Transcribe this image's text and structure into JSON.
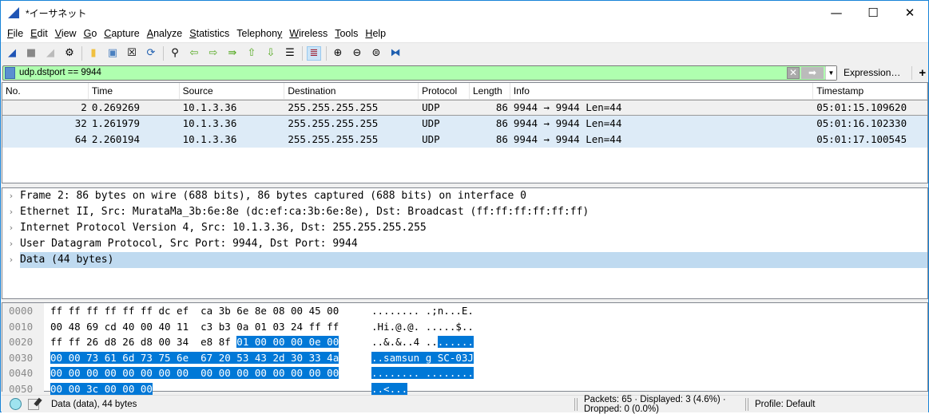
{
  "window": {
    "title": "*イーサネット",
    "controls": {
      "minimize": "—",
      "maximize": "☐",
      "close": "✕"
    }
  },
  "menu": [
    {
      "label": "File",
      "key": "F",
      "rest": "ile"
    },
    {
      "label": "Edit",
      "key": "E",
      "rest": "dit"
    },
    {
      "label": "View",
      "key": "V",
      "rest": "iew"
    },
    {
      "label": "Go",
      "key": "G",
      "rest": "o"
    },
    {
      "label": "Capture",
      "key": "C",
      "rest": "apture"
    },
    {
      "label": "Analyze",
      "key": "A",
      "rest": "nalyze"
    },
    {
      "label": "Statistics",
      "key": "S",
      "rest": "tatistics"
    },
    {
      "label": "Telephony",
      "key": "Telephon",
      "rest": "y"
    },
    {
      "label": "Wireless",
      "key": "W",
      "rest": "ireless"
    },
    {
      "label": "Tools",
      "key": "T",
      "rest": "ools"
    },
    {
      "label": "Help",
      "key": "H",
      "rest": "elp"
    }
  ],
  "toolbar": [
    "start-capture",
    "stop-capture",
    "restart-capture",
    "capture-options",
    "open-file",
    "save-file",
    "close-file",
    "reload-file",
    "find-packet",
    "go-back",
    "go-forward",
    "go-to-packet",
    "go-first",
    "go-last",
    "auto-scroll",
    "colorize",
    "zoom-in",
    "zoom-out",
    "zoom-normal",
    "resize-columns"
  ],
  "filter": {
    "value": "udp.dstport == 9944",
    "expression_label": "Expression…",
    "add_label": "+",
    "bg": "#afffaf"
  },
  "packet_list": {
    "columns": [
      "No.",
      "Time",
      "Source",
      "Destination",
      "Protocol",
      "Length",
      "Info",
      "Timestamp"
    ],
    "rows": [
      {
        "no": "2",
        "time": "0.269269",
        "src": "10.1.3.36",
        "dst": "255.255.255.255",
        "proto": "UDP",
        "len": "86",
        "info": "9944 → 9944 Len=44",
        "ts": "05:01:15.109620",
        "selected": true
      },
      {
        "no": "32",
        "time": "1.261979",
        "src": "10.1.3.36",
        "dst": "255.255.255.255",
        "proto": "UDP",
        "len": "86",
        "info": "9944 → 9944 Len=44",
        "ts": "05:01:16.102330"
      },
      {
        "no": "64",
        "time": "2.260194",
        "src": "10.1.3.36",
        "dst": "255.255.255.255",
        "proto": "UDP",
        "len": "86",
        "info": "9944 → 9944 Len=44",
        "ts": "05:01:17.100545"
      }
    ]
  },
  "details": [
    "Frame 2: 86 bytes on wire (688 bits), 86 bytes captured (688 bits) on interface 0",
    "Ethernet II, Src: MurataMa_3b:6e:8e (dc:ef:ca:3b:6e:8e), Dst: Broadcast (ff:ff:ff:ff:ff:ff)",
    "Internet Protocol Version 4, Src: 10.1.3.36, Dst: 255.255.255.255",
    "User Datagram Protocol, Src Port: 9944, Dst Port: 9944",
    "Data (44 bytes)"
  ],
  "bytes": [
    {
      "off": "0000",
      "hex_plain": "ff ff ff ff ff ff dc ef  ca 3b 6e 8e 08 00 45 00",
      "hex_sel": "",
      "asc_plain": "........ .;n...E.",
      "asc_sel": ""
    },
    {
      "off": "0010",
      "hex_plain": "00 48 69 cd 40 00 40 11  c3 b3 0a 01 03 24 ff ff",
      "hex_sel": "",
      "asc_plain": ".Hi.@.@. .....$..",
      "asc_sel": ""
    },
    {
      "off": "0020",
      "hex_plain": "ff ff 26 d8 26 d8 00 34  e8 8f ",
      "hex_sel": "01 00 00 00 0e 00",
      "asc_plain": "..&.&..4 ..",
      "asc_sel": "......"
    },
    {
      "off": "0030",
      "hex_plain": "",
      "hex_sel": "00 00 73 61 6d 73 75 6e  67 20 53 43 2d 30 33 4a",
      "asc_plain": "",
      "asc_sel": "..samsun g SC-03J"
    },
    {
      "off": "0040",
      "hex_plain": "",
      "hex_sel": "00 00 00 00 00 00 00 00  00 00 00 00 00 00 00 00",
      "asc_plain": "",
      "asc_sel": "........ ........"
    },
    {
      "off": "0050",
      "hex_plain": "",
      "hex_sel": "00 00 3c 00 00 00",
      "asc_plain": "",
      "asc_sel": "..<..."
    }
  ],
  "status": {
    "field": "Data (data), 44 bytes",
    "packets": "Packets: 65 · Displayed: 3 (4.6%) · Dropped: 0 (0.0%)",
    "profile": "Profile: Default"
  }
}
